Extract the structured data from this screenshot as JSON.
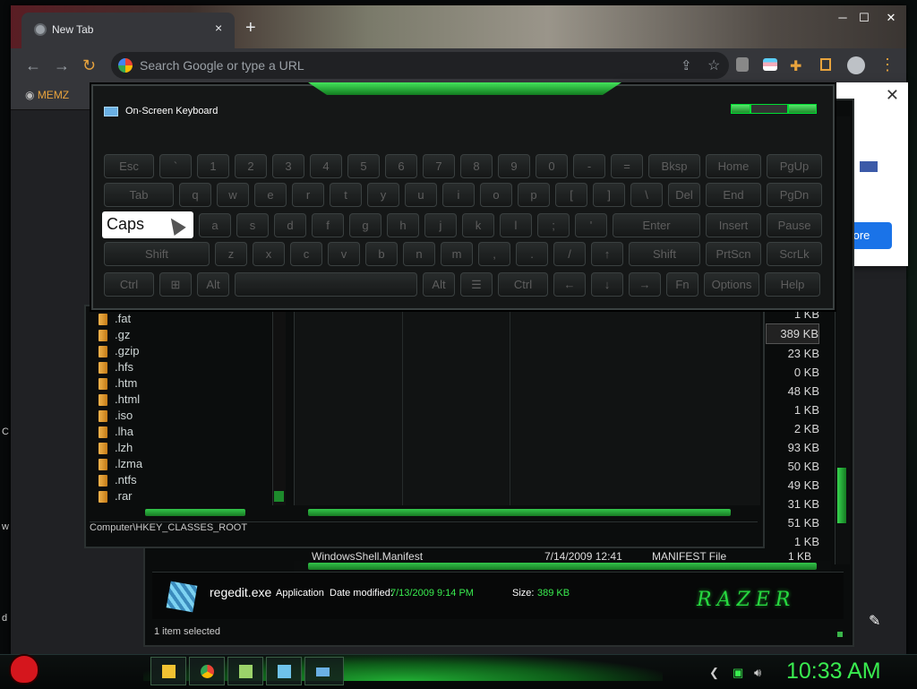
{
  "browser": {
    "tab_title": "New Tab",
    "tab_close": "×",
    "new_tab": "+",
    "omnibox_placeholder": "Search Google or type a URL",
    "bookmark": "MEMZ",
    "window_controls": [
      "─",
      "☐",
      "✕"
    ]
  },
  "popup": {
    "close": "✕",
    "button_label": "ore"
  },
  "explorer": {
    "sizes": [
      "1 KB",
      "389 KB",
      "23 KB",
      "0 KB",
      "48 KB",
      "1 KB",
      "2 KB",
      "93 KB",
      "50 KB",
      "49 KB",
      "31 KB",
      "51 KB",
      "1 KB"
    ],
    "tree": [
      ".fat",
      ".gz",
      ".gzip",
      ".hfs",
      ".htm",
      ".html",
      ".iso",
      ".lha",
      ".lzh",
      ".lzma",
      ".ntfs",
      ".rar"
    ],
    "path": "Computer\\HKEY_CLASSES_ROOT",
    "file_row": {
      "name": "WindowsShell.Manifest",
      "date": "7/14/2009 12:41",
      "type": "MANIFEST File",
      "size": "1 KB"
    },
    "details": {
      "name": "regedit.exe",
      "kind": "Application",
      "date_label": "Date modified:",
      "date": "7/13/2009 9:14 PM",
      "size_label": "Size:",
      "size": "389 KB"
    },
    "brand": "RAZER",
    "status": "1 item selected"
  },
  "keyboard": {
    "title": "On-Screen Keyboard",
    "caps_label": "Caps",
    "rows": [
      [
        "Esc",
        "`",
        "1",
        "2",
        "3",
        "4",
        "5",
        "6",
        "7",
        "8",
        "9",
        "0",
        "-",
        "=",
        "Bksp",
        "Home",
        "PgUp"
      ],
      [
        "Tab",
        "q",
        "w",
        "e",
        "r",
        "t",
        "y",
        "u",
        "i",
        "o",
        "p",
        "[",
        "]",
        "\\",
        "Del",
        "End",
        "PgDn"
      ],
      [
        "a",
        "s",
        "d",
        "f",
        "g",
        "h",
        "j",
        "k",
        "l",
        ";",
        "'",
        "Enter",
        "Insert",
        "Pause"
      ],
      [
        "Shift",
        "z",
        "x",
        "c",
        "v",
        "b",
        "n",
        "m",
        ",",
        ".",
        "/",
        "↑",
        "Shift",
        "PrtScn",
        "ScrLk"
      ],
      [
        "Ctrl",
        "⊞",
        "Alt",
        "",
        "Alt",
        "☰",
        "Ctrl",
        "←",
        "↓",
        "→",
        "Fn",
        "Options",
        "Help"
      ]
    ]
  },
  "taskbar": {
    "clock": "10:33 AM"
  }
}
